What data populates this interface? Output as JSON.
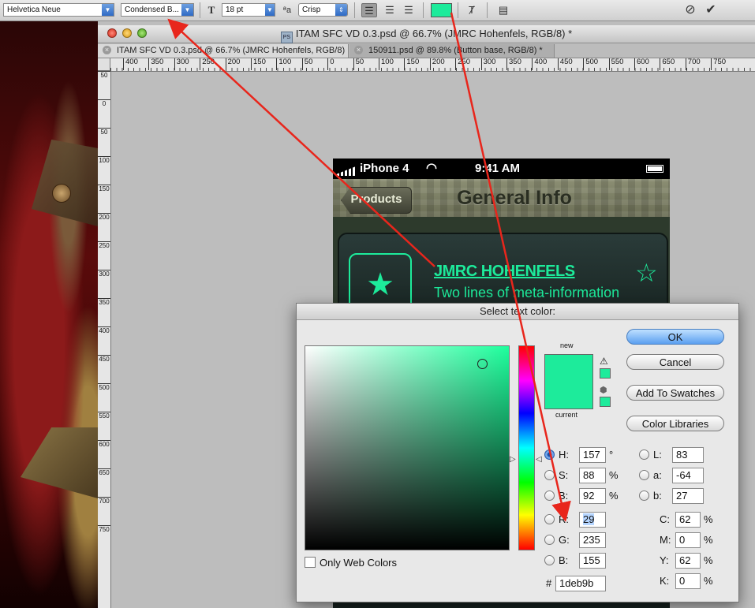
{
  "options_bar": {
    "font_family": "Helvetica Neue",
    "font_style": "Condensed B...",
    "font_size": "18 pt",
    "antialias": "Crisp",
    "text_color": "#1deb9b",
    "icons": [
      "text-orientation-icon",
      "antialias-icon",
      "align-left-icon",
      "align-center-icon",
      "align-right-icon",
      "color-swatch",
      "warp-text-icon",
      "character-panel-icon",
      "cancel-icon",
      "commit-icon"
    ]
  },
  "document": {
    "title": "ITAM SFC VD 0.3.psd @ 66.7% (JMRC Hohenfels, RGB/8) *",
    "tabs": [
      {
        "label": "ITAM SFC VD 0.3.psd @ 66.7% (JMRC Hohenfels, RGB/8) *"
      },
      {
        "label": "150911.psd @ 89.8% (Button base, RGB/8) *"
      }
    ],
    "hruler": [
      "400",
      "350",
      "300",
      "250",
      "200",
      "150",
      "100",
      "50",
      "0",
      "50",
      "100",
      "150",
      "200",
      "250",
      "300",
      "350",
      "400",
      "450",
      "500",
      "550",
      "600",
      "650",
      "700",
      "750"
    ],
    "vruler": [
      "50",
      "0",
      "50",
      "100",
      "150",
      "200",
      "250",
      "300",
      "350",
      "400",
      "450",
      "500",
      "550",
      "600",
      "650",
      "700",
      "750"
    ]
  },
  "phone": {
    "carrier": "iPhone 4",
    "time": "9:41 AM",
    "back_label": "Products",
    "nav_title": "General Info",
    "card_title": "JMRC HOHENFELS",
    "card_subtitle": "Two lines of meta-information"
  },
  "picker": {
    "title": "Select text color:",
    "label_new": "new",
    "label_current": "current",
    "color": "#1deb9b",
    "buttons": {
      "ok": "OK",
      "cancel": "Cancel",
      "swatches": "Add To Swatches",
      "libraries": "Color Libraries"
    },
    "hsb": [
      {
        "label": "H:",
        "value": "157",
        "unit": "°"
      },
      {
        "label": "S:",
        "value": "88",
        "unit": "%"
      },
      {
        "label": "B:",
        "value": "92",
        "unit": "%"
      }
    ],
    "rgb": [
      {
        "label": "R:",
        "value": "29"
      },
      {
        "label": "G:",
        "value": "235"
      },
      {
        "label": "B:",
        "value": "155"
      }
    ],
    "lab": [
      {
        "label": "L:",
        "value": "83"
      },
      {
        "label": "a:",
        "value": "-64"
      },
      {
        "label": "b:",
        "value": "27"
      }
    ],
    "cmyk": [
      {
        "label": "C:",
        "value": "62",
        "unit": "%"
      },
      {
        "label": "M:",
        "value": "0",
        "unit": "%"
      },
      {
        "label": "Y:",
        "value": "62",
        "unit": "%"
      },
      {
        "label": "K:",
        "value": "0",
        "unit": "%"
      }
    ],
    "hex_label": "#",
    "hex": "1deb9b",
    "only_web_colors": "Only Web Colors"
  }
}
